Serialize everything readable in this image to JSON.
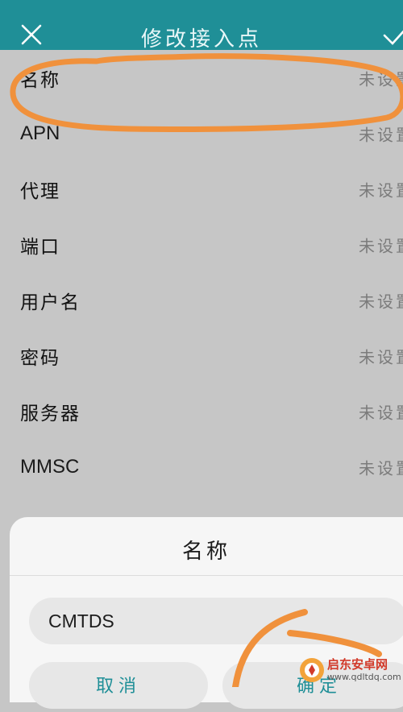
{
  "header": {
    "title": "修改接入点",
    "close_icon": "close-icon",
    "confirm_icon": "check-icon"
  },
  "apn_fields": [
    {
      "label": "名称",
      "value": "未设置"
    },
    {
      "label": "APN",
      "value": "未设置"
    },
    {
      "label": "代理",
      "value": "未设置"
    },
    {
      "label": "端口",
      "value": "未设置"
    },
    {
      "label": "用户名",
      "value": "未设置"
    },
    {
      "label": "密码",
      "value": "未设置"
    },
    {
      "label": "服务器",
      "value": "未设置"
    },
    {
      "label": "MMSC",
      "value": "未设置"
    }
  ],
  "dialog": {
    "title": "名称",
    "input_value": "CMTDS",
    "cancel_label": "取消",
    "ok_label": "确定"
  },
  "watermark": {
    "brand": "启东安卓网",
    "url": "www.qdltdq.com"
  },
  "colors": {
    "header_bg": "#1f8f97",
    "annotation": "#f0913c"
  }
}
